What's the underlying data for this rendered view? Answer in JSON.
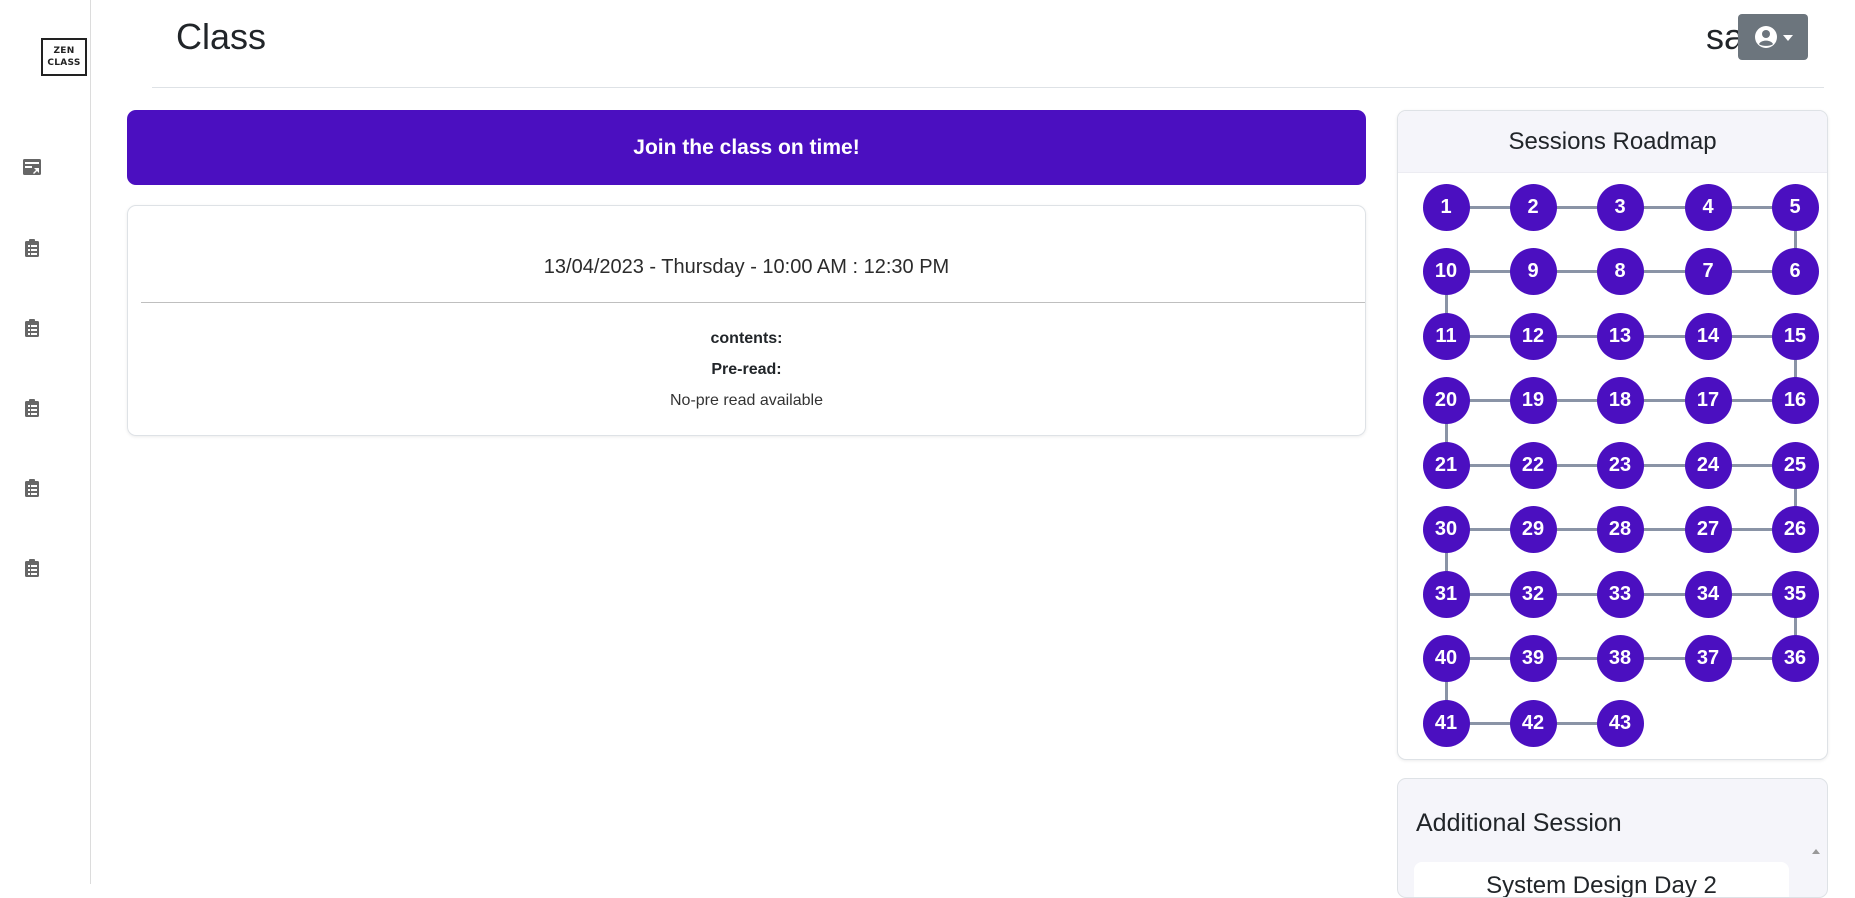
{
  "sidebar": {
    "logo_line1": "ZEN",
    "logo_line2": "CLASS",
    "icons": [
      "dashboard-icon",
      "clipboard-list-icon",
      "clipboard-list-icon",
      "clipboard-list-icon",
      "clipboard-list-icon",
      "clipboard-list-icon"
    ]
  },
  "header": {
    "title": "Class",
    "user_name": "sai",
    "user_button_icon": "user-circle-icon"
  },
  "banner": {
    "text": "Join the class on time!"
  },
  "class_card": {
    "datetime": "13/04/2023 - Thursday - 10:00 AM : 12:30 PM",
    "contents_label": "contents:",
    "preread_label": "Pre-read:",
    "no_preread": "No-pre read available"
  },
  "roadmap": {
    "title": "Sessions Roadmap",
    "sessions": [
      1,
      2,
      3,
      4,
      5,
      6,
      7,
      8,
      9,
      10,
      11,
      12,
      13,
      14,
      15,
      16,
      17,
      18,
      19,
      20,
      21,
      22,
      23,
      24,
      25,
      26,
      27,
      28,
      29,
      30,
      31,
      32,
      33,
      34,
      35,
      36,
      37,
      38,
      39,
      40,
      41,
      42,
      43
    ]
  },
  "additional_session": {
    "title": "Additional Session",
    "items": [
      "System Design Day 2"
    ]
  },
  "colors": {
    "accent": "#4b0fc0",
    "connector": "#8a94a6",
    "user_button": "#6c757d"
  }
}
